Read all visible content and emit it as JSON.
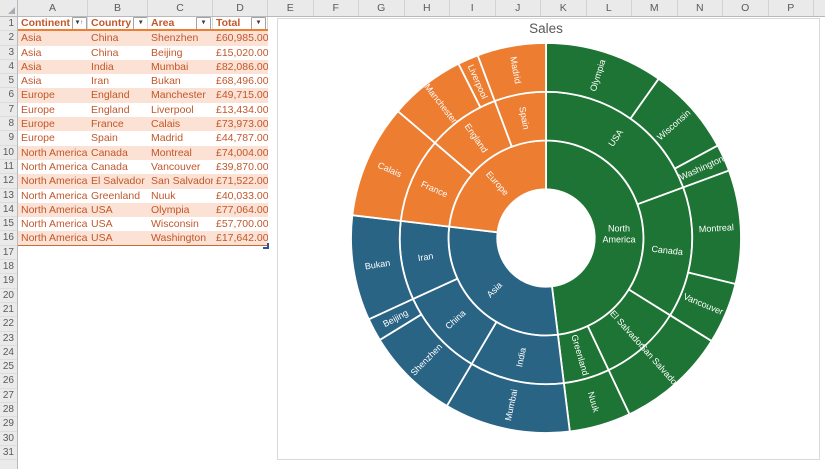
{
  "sheet": {
    "column_letters": [
      "A",
      "B",
      "C",
      "D",
      "E",
      "F",
      "G",
      "H",
      "I",
      "J",
      "K",
      "L",
      "M",
      "N",
      "O",
      "P"
    ],
    "row_count": 31
  },
  "table": {
    "headers": [
      {
        "label": "Continent",
        "sort": "asc"
      },
      {
        "label": "Country"
      },
      {
        "label": "Area"
      },
      {
        "label": "Total"
      }
    ],
    "rows": [
      [
        "Asia",
        "China",
        "Shenzhen",
        "£60,985.00"
      ],
      [
        "Asia",
        "China",
        "Beijing",
        "£15,020.00"
      ],
      [
        "Asia",
        "India",
        "Mumbai",
        "£82,086.00"
      ],
      [
        "Asia",
        "Iran",
        "Bukan",
        "£68,496.00"
      ],
      [
        "Europe",
        "England",
        "Manchester",
        "£49,715.00"
      ],
      [
        "Europe",
        "England",
        "Liverpool",
        "£13,434.00"
      ],
      [
        "Europe",
        "France",
        "Calais",
        "£73,973.00"
      ],
      [
        "Europe",
        "Spain",
        "Madrid",
        "£44,787.00"
      ],
      [
        "North America",
        "Canada",
        "Montreal",
        "£74,004.00"
      ],
      [
        "North America",
        "Canada",
        "Vancouver",
        "£39,870.00"
      ],
      [
        "North America",
        "El Salvador",
        "San Salvador",
        "£71,522.00"
      ],
      [
        "North America",
        "Greenland",
        "Nuuk",
        "£40,033.00"
      ],
      [
        "North America",
        "USA",
        "Olympia",
        "£77,064.00"
      ],
      [
        "North America",
        "USA",
        "Wisconsin",
        "£57,700.00"
      ],
      [
        "North America",
        "USA",
        "Washington",
        "£17,642.00"
      ]
    ],
    "style": {
      "header_text": "#963A21",
      "data_text": "#C2572B",
      "band_fill": "#FBE2D4",
      "header_border": "#ED7D31",
      "bottom_border": "#C96A35"
    }
  },
  "chart_data": {
    "type": "sunburst",
    "title": "Sales",
    "title_color": "#595959",
    "levels": [
      "Continent",
      "Country",
      "Area"
    ],
    "legend": "none",
    "label_color": "#FFFFFF",
    "colors": {
      "North America": "#1E7434",
      "Asia": "#2A6485",
      "Europe": "#EC7D31"
    },
    "children": [
      {
        "label": "North America",
        "value": 377835,
        "children": [
          {
            "label": "USA",
            "value": 152406,
            "children": [
              {
                "label": "Olympia",
                "value": 77064
              },
              {
                "label": "Wisconsin",
                "value": 57700
              },
              {
                "label": "Washington",
                "value": 17642
              }
            ]
          },
          {
            "label": "Canada",
            "value": 113874,
            "children": [
              {
                "label": "Montreal",
                "value": 74004
              },
              {
                "label": "Vancouver",
                "value": 39870
              }
            ]
          },
          {
            "label": "El Salvador",
            "value": 71522,
            "children": [
              {
                "label": "San Salvador",
                "value": 71522
              }
            ]
          },
          {
            "label": "Greenland",
            "value": 40033,
            "children": [
              {
                "label": "Nuuk",
                "value": 40033
              }
            ]
          }
        ]
      },
      {
        "label": "Asia",
        "value": 226587,
        "children": [
          {
            "label": "India",
            "value": 82086,
            "children": [
              {
                "label": "Mumbai",
                "value": 82086
              }
            ]
          },
          {
            "label": "China",
            "value": 76005,
            "children": [
              {
                "label": "Shenzhen",
                "value": 60985
              },
              {
                "label": "Beijing",
                "value": 15020
              }
            ]
          },
          {
            "label": "Iran",
            "value": 68496,
            "children": [
              {
                "label": "Bukan",
                "value": 68496
              }
            ]
          }
        ]
      },
      {
        "label": "Europe",
        "value": 181909,
        "children": [
          {
            "label": "France",
            "value": 73973,
            "children": [
              {
                "label": "Calais",
                "value": 73973
              }
            ]
          },
          {
            "label": "England",
            "value": 63149,
            "children": [
              {
                "label": "Manchester",
                "value": 49715
              },
              {
                "label": "Liverpool",
                "value": 13434
              }
            ]
          },
          {
            "label": "Spain",
            "value": 44787,
            "children": [
              {
                "label": "Madrid",
                "value": 44787
              }
            ]
          }
        ]
      }
    ]
  }
}
